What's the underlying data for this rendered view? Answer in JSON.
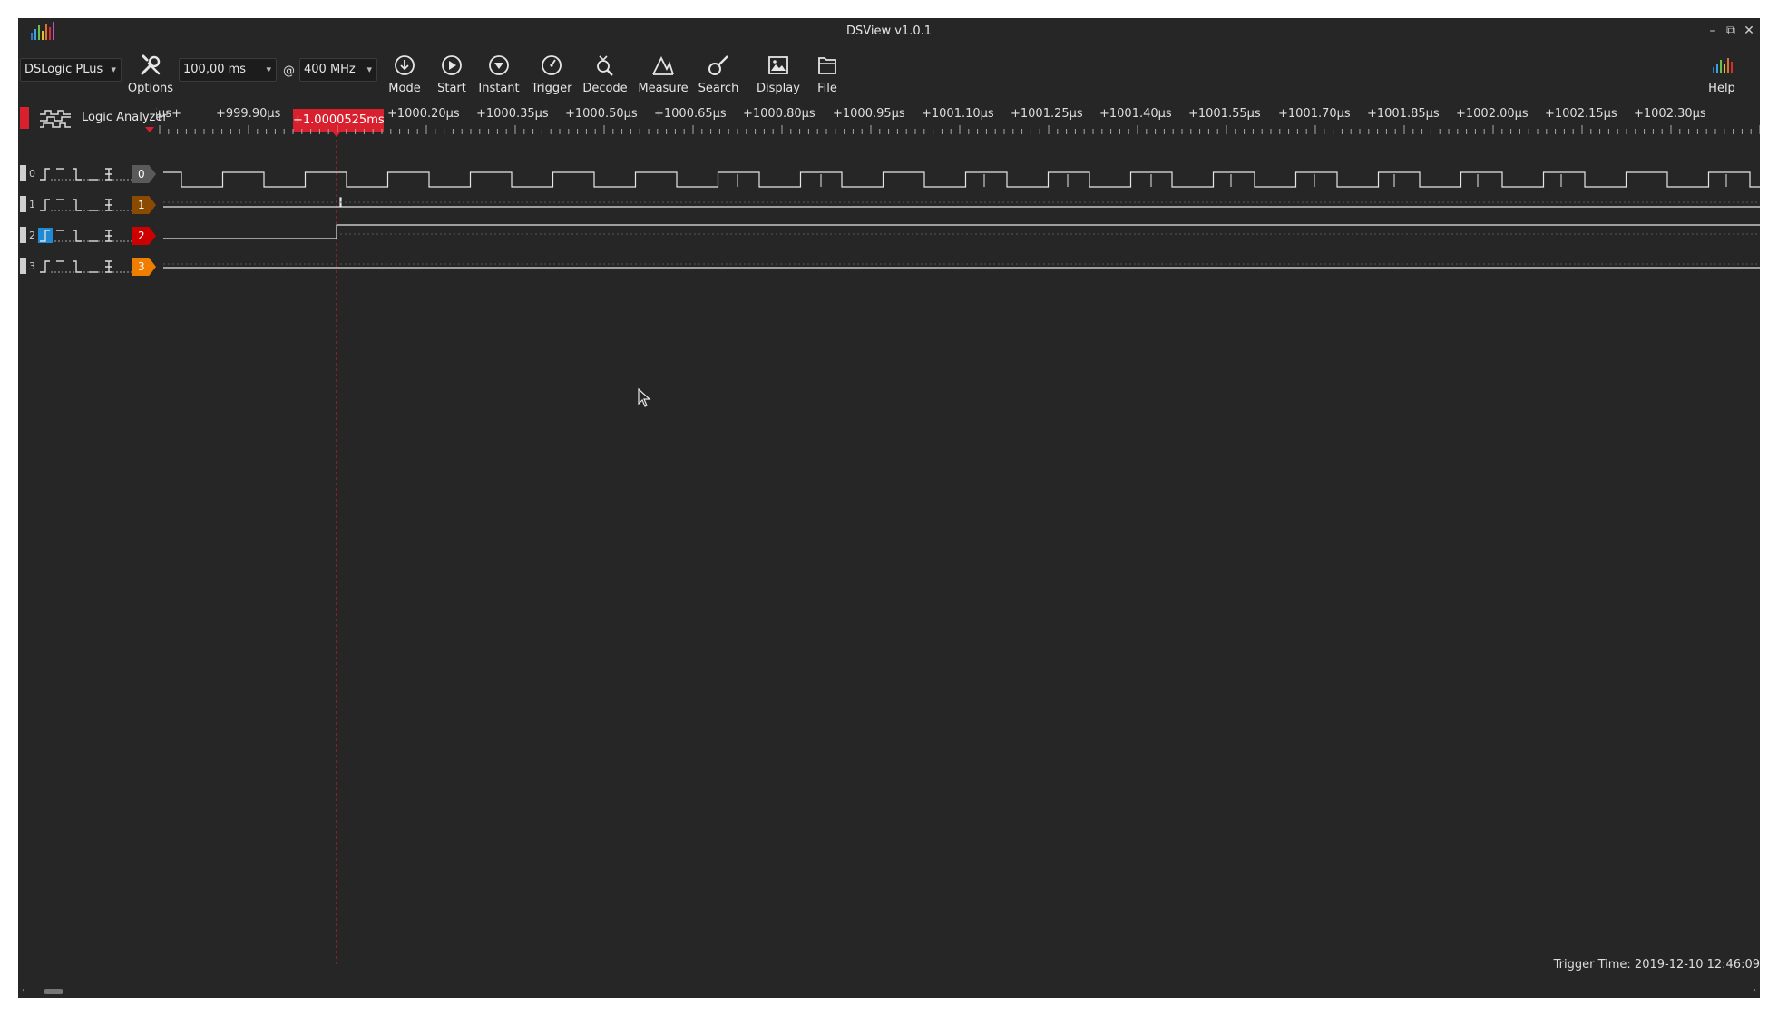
{
  "window": {
    "title": "DSView v1.0.1",
    "minimize": "–",
    "restore": "⧉",
    "close": "✕"
  },
  "toolbar": {
    "device": "DSLogic PLus",
    "duration": "100,00 ms",
    "at": "@",
    "rate": "400 MHz",
    "buttons": [
      {
        "label": "Options",
        "icon": "wrench-screwdriver-icon"
      },
      {
        "label": "Mode",
        "icon": "mode-icon"
      },
      {
        "label": "Start",
        "icon": "play-icon"
      },
      {
        "label": "Instant",
        "icon": "instant-icon"
      },
      {
        "label": "Trigger",
        "icon": "trigger-icon"
      },
      {
        "label": "Decode",
        "icon": "decode-icon"
      },
      {
        "label": "Measure",
        "icon": "measure-icon"
      },
      {
        "label": "Search",
        "icon": "search-icon"
      },
      {
        "label": "Display",
        "icon": "display-icon"
      },
      {
        "label": "File",
        "icon": "file-icon"
      },
      {
        "label": "Help",
        "icon": "help-icon"
      }
    ]
  },
  "ruler": {
    "mode_label": "Logic Analyzer",
    "trigger_label": "+1.0000525ms",
    "labels": [
      "+999.75µs",
      "+999.90µs",
      "+1000.20µs",
      "+1000.35µs",
      "+1000.50µs",
      "+1000.65µs",
      "+1000.80µs",
      "+1000.95µs",
      "+1001.10µs",
      "+1001.25µs",
      "+1001.40µs",
      "+1001.55µs",
      "+1001.70µs",
      "+1001.85µs",
      "+1002.00µs",
      "+1002.15µs",
      "+1002.30µs"
    ]
  },
  "channels": [
    {
      "index": "0",
      "color": "#5a5a5a"
    },
    {
      "index": "1",
      "color": "#8a4b00"
    },
    {
      "index": "2",
      "color": "#cc0000"
    },
    {
      "index": "3",
      "color": "#f07d00"
    }
  ],
  "status": {
    "trigger_time": "Trigger Time: 2019-12-10 12:46:09"
  },
  "colors": {
    "accent": "#d9202e",
    "selected_trigger": "#1f8ad6",
    "background": "#262626"
  }
}
